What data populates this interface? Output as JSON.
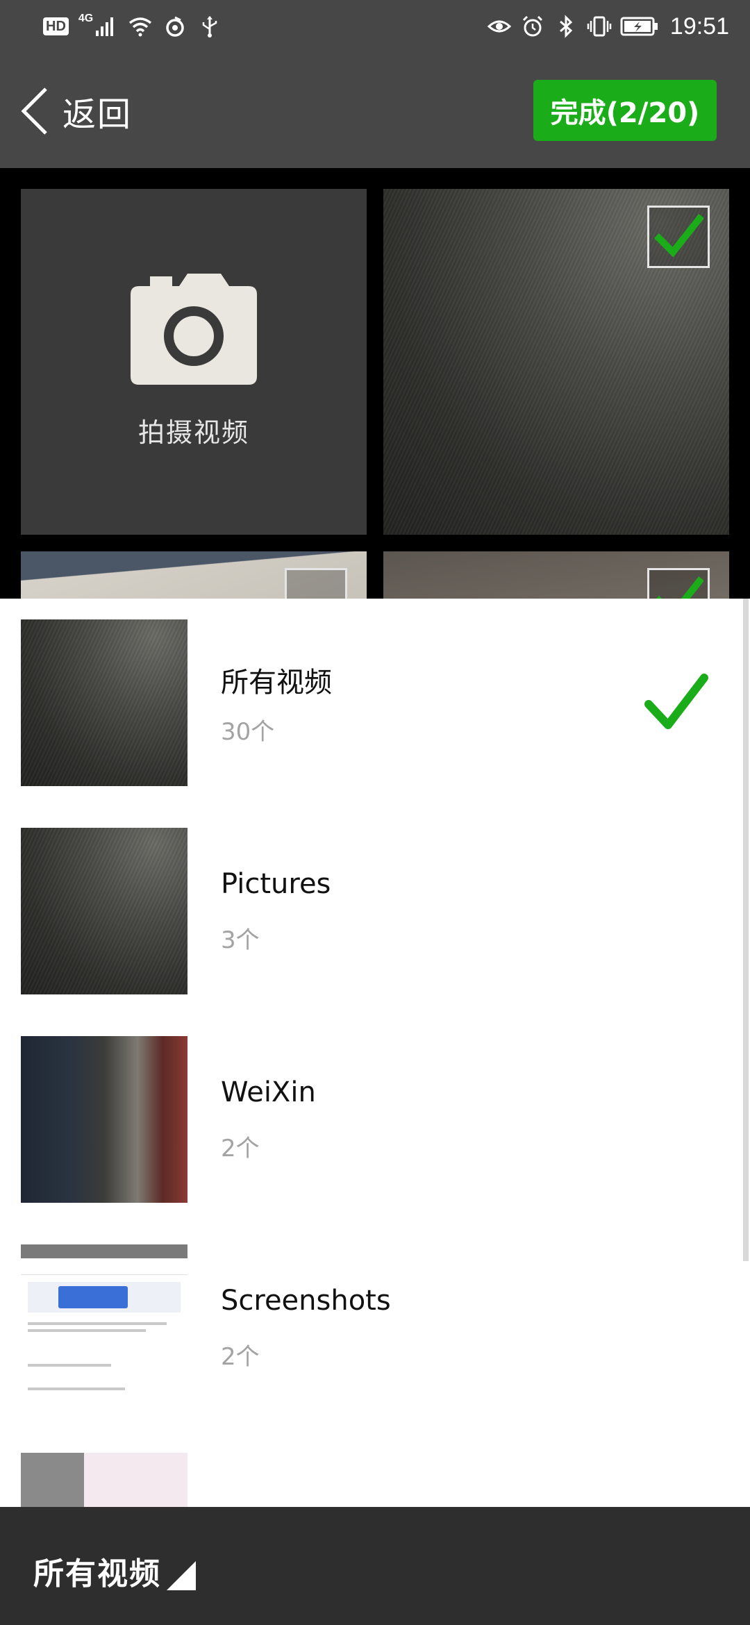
{
  "status_bar": {
    "left_badges": [
      "HD",
      "4G"
    ],
    "icons_left": [
      "signal-icon",
      "wifi-icon",
      "data-sync-icon",
      "usb-icon"
    ],
    "icons_right": [
      "eye-icon",
      "alarm-icon",
      "bluetooth-icon",
      "vibrate-icon",
      "battery-icon"
    ],
    "time": "19:51"
  },
  "top_bar": {
    "back_label": "返回",
    "done_label": "完成(2/20)",
    "accent_color": "#1aad19"
  },
  "grid": {
    "camera_label": "拍摄视频",
    "items": [
      {
        "checked": true
      },
      {
        "checked": false
      },
      {
        "checked": true
      }
    ]
  },
  "albums": [
    {
      "name": "所有视频",
      "count": "30个",
      "selected": true
    },
    {
      "name": "Pictures",
      "count": "3个",
      "selected": false
    },
    {
      "name": "WeiXin",
      "count": "2个",
      "selected": false
    },
    {
      "name": "Screenshots",
      "count": "2个",
      "selected": false
    }
  ],
  "bottom_bar": {
    "folder_label": "所有视频"
  }
}
